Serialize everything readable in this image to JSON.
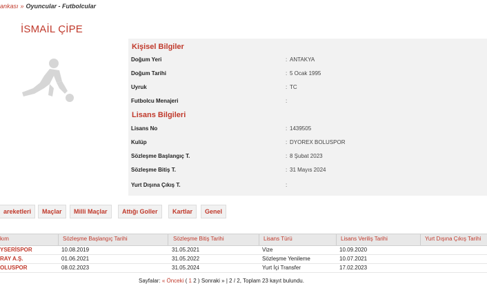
{
  "breadcrumb": {
    "parent": "ankası",
    "separator": "»",
    "current": "Oyuncular - Futbolcular"
  },
  "player": {
    "name": "İSMAİL ÇİPE",
    "photo_icon": "player-silhouette-icon"
  },
  "personal": {
    "title": "Kişisel Bilgiler",
    "rows": [
      {
        "label": "Doğum Yeri",
        "colon": ":",
        "value": "ANTAKYA"
      },
      {
        "label": "Doğum Tarihi",
        "colon": ":",
        "value": "5 Ocak 1995"
      },
      {
        "label": "Uyruk",
        "colon": ":",
        "value": "TC"
      },
      {
        "label": "Futbolcu Menajeri",
        "colon": ":",
        "value": ""
      }
    ]
  },
  "license": {
    "title": "Lisans Bilgileri",
    "rows": [
      {
        "label": "Lisans No",
        "colon": ":",
        "value": "1439505"
      },
      {
        "label": "Kulüp",
        "colon": ":",
        "value": "DYOREX BOLUSPOR"
      },
      {
        "label": "Sözleşme Başlangıç T.",
        "colon": ":",
        "value": "8 Şubat 2023"
      },
      {
        "label": "Sözleşme Bitiş T.",
        "colon": ":",
        "value": "31 Mayıs 2024"
      },
      {
        "label": "Yurt Dışına Çıkış T.",
        "colon": ":",
        "value": ""
      }
    ]
  },
  "tabs": [
    "areketleri",
    "Maçlar",
    "Milli Maçlar",
    "Attığı Goller",
    "Kartlar",
    "Genel"
  ],
  "table": {
    "headers": [
      "kım",
      "Sözleşme Başlangıç Tarihi",
      "Sözleşme Bitiş Tarihi",
      "Lisans Türü",
      "Lisans Veriliş Tarihi",
      "Yurt Dışına Çıkış Tarihi"
    ],
    "rows": [
      [
        "YSERİSPOR",
        "10.08.2019",
        "31.05.2021",
        "Vize",
        "10.09.2020",
        ""
      ],
      [
        "RAY A.Ş.",
        "01.06.2021",
        "31.05.2022",
        "Sözleşme Yenileme",
        "10.07.2021",
        ""
      ],
      [
        "OLUSPOR",
        "08.02.2023",
        "31.05.2024",
        "Yurt İçi Transfer",
        "17.02.2023",
        ""
      ]
    ]
  },
  "pager": {
    "label": "Sayfalar:",
    "prev": "« Önceki",
    "open_paren": "(",
    "page1": "1",
    "page2": "2",
    "close_paren": ")",
    "next": "Sonraki »",
    "summary": "| 2 / 2, Toplam 23 kayıt bulundu."
  },
  "colors": {
    "accent": "#c0392b",
    "panel_bg": "#f2f2f2",
    "header_bg": "#e8e8e8"
  }
}
